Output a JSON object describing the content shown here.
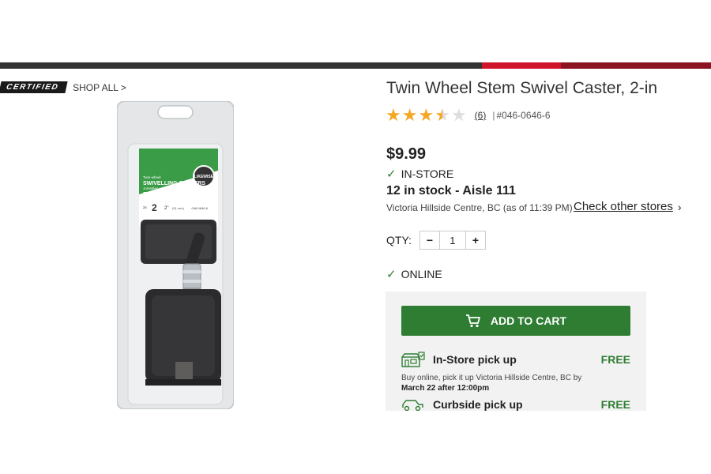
{
  "brand": {
    "badge": "CERTIFIED",
    "shop_all": "SHOP ALL >"
  },
  "product": {
    "title": "Twin Wheel Stem Swivel Caster, 2-in",
    "rating": 3.5,
    "rating_max": 5,
    "review_count": "(6)",
    "separator": "|",
    "sku": "#046-0646-6",
    "price": "$9.99",
    "image_icon": "swivel-caster-package",
    "package": {
      "brand": "LIKEWISE",
      "line1": "Twin-wheel",
      "line2": "SWIVELLING CASTERS",
      "line3": "Jumelées",
      "line4": "ROULETTES PIVOTANTES",
      "qty_prefix": "2x",
      "qty": "2",
      "size": "2\"",
      "size_mm": "(51 mm)",
      "code": "046-0646-6"
    }
  },
  "instore": {
    "label": "IN-STORE",
    "stock": "12 in stock - Aisle 111",
    "store": "Victoria Hillside Centre, BC (as of 11:39 PM)",
    "check_other": "Check other stores",
    "chevron": "›"
  },
  "qty": {
    "label": "QTY:",
    "minus": "−",
    "value": "1",
    "plus": "+"
  },
  "online": {
    "label": "ONLINE"
  },
  "cart": {
    "label": "ADD TO CART"
  },
  "fulfillment": [
    {
      "title": "In-Store pick up",
      "price": "FREE",
      "desc_line1": "Buy online, pick it up Victoria Hillside Centre, BC by",
      "desc_line2": "March 22 after 12:00pm",
      "icon": "store-icon"
    },
    {
      "title": "Curbside pick up",
      "price": "FREE",
      "icon": "car-icon"
    }
  ],
  "colors": {
    "accent_green": "#2e7d32",
    "brand_red": "#d0142b",
    "star": "#f5a623"
  }
}
